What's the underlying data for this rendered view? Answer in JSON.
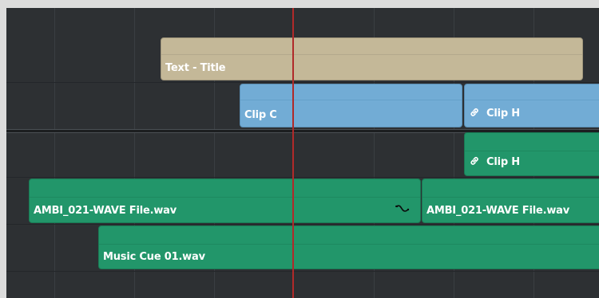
{
  "timeline": {
    "clips": {
      "title": {
        "label": "Text - Title"
      },
      "clip_c": {
        "label": "Clip C"
      },
      "clip_h_video": {
        "label": "Clip H",
        "linked": true
      },
      "clip_h_audio": {
        "label": "Clip H",
        "linked": true
      },
      "ambi_1": {
        "label": "AMBI_021-WAVE File.wav"
      },
      "ambi_2": {
        "label": "AMBI_021-WAVE File.wav"
      },
      "music": {
        "label": "Music Cue 01.wav"
      }
    },
    "colors": {
      "background": "#2d3033",
      "title_clip": "#c4b898",
      "video_clip": "#72acd5",
      "audio_clip": "#22966a",
      "playhead": "#b02a2a"
    },
    "icons": {
      "link": "link-icon",
      "audio_fade": "audio-fade-icon"
    }
  }
}
